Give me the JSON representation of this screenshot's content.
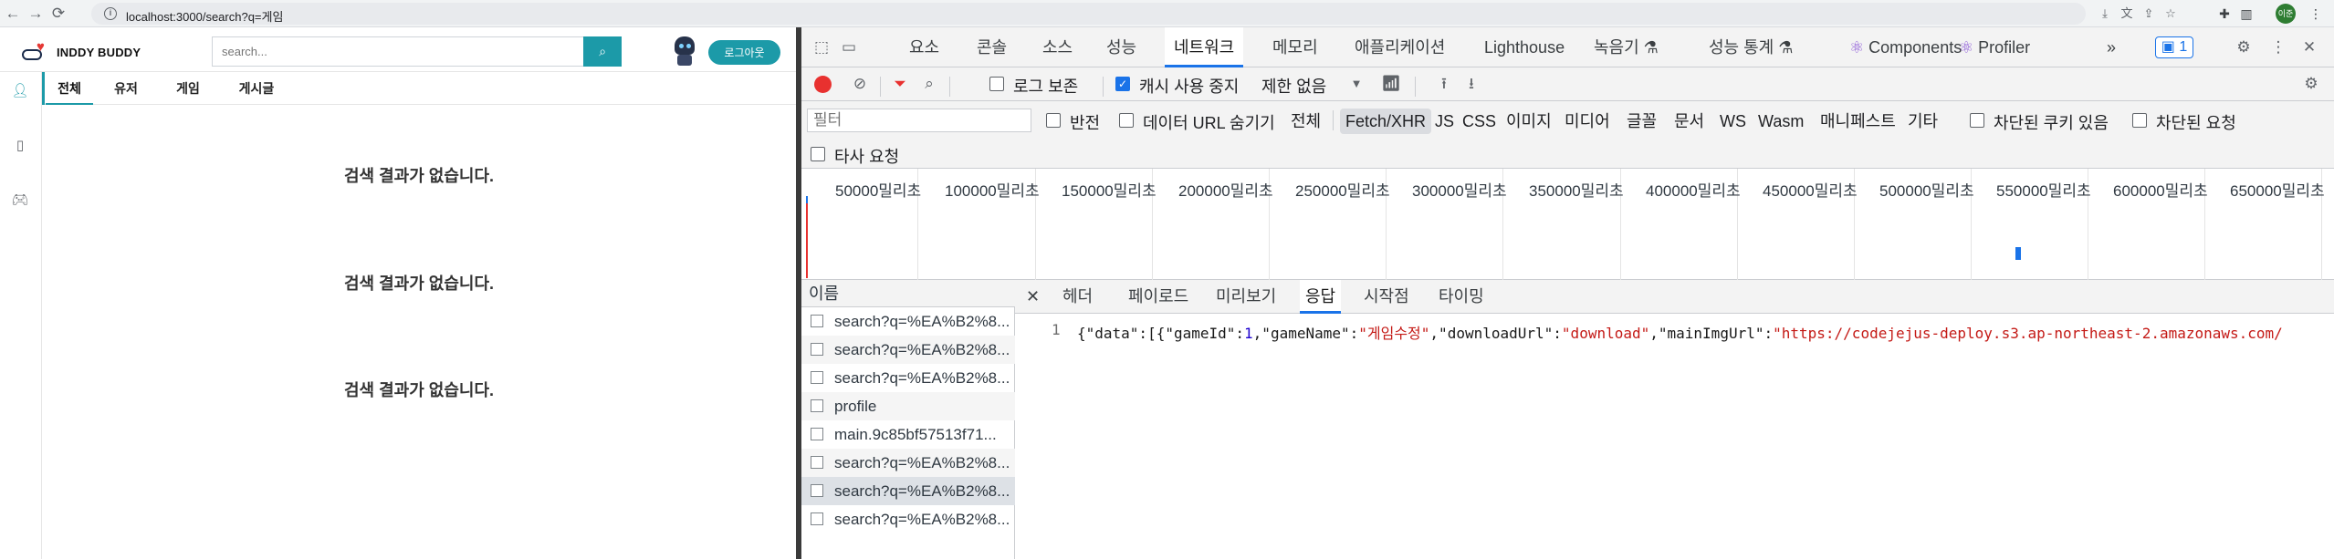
{
  "browser": {
    "url": "localhost:3000/search?q=게임",
    "profile_initials": "이준"
  },
  "site": {
    "brand": "INDDY BUDDY",
    "search_placeholder": "search...",
    "login_label": "로그아웃",
    "tabs": [
      "전체",
      "유저",
      "게임",
      "게시글"
    ],
    "empty_message": "검색 결과가 없습니다."
  },
  "devtools": {
    "tabs": [
      "요소",
      "콘솔",
      "소스",
      "성능",
      "네트워크",
      "메모리",
      "애플리케이션",
      "Lighthouse",
      "녹음기 ⚗",
      "성능 통계 ⚗",
      "Components",
      "Profiler"
    ],
    "selected_tab": "네트워크",
    "issues_count": "1",
    "toolbar": {
      "preserve_log": "로그 보존",
      "disable_cache": "캐시 사용 중지",
      "throttling": "제한 없음"
    },
    "filter": {
      "placeholder": "필터",
      "invert": "반전",
      "hide_data_urls": "데이터 URL 숨기기",
      "types": [
        "전체",
        "Fetch/XHR",
        "JS",
        "CSS",
        "이미지",
        "미디어",
        "글꼴",
        "문서",
        "WS",
        "Wasm",
        "매니페스트",
        "기타"
      ],
      "selected_type": "Fetch/XHR",
      "blocked_cookies": "차단된 쿠키 있음",
      "blocked_requests": "차단된 요청",
      "third_party": "타사 요청"
    },
    "timeline_labels": [
      "50000밀리초",
      "100000밀리초",
      "150000밀리초",
      "200000밀리초",
      "250000밀리초",
      "300000밀리초",
      "350000밀리초",
      "400000밀리초",
      "450000밀리초",
      "500000밀리초",
      "550000밀리초",
      "600000밀리초",
      "650000밀리초"
    ],
    "name_header": "이름",
    "requests": [
      "search?q=%EA%B2%8...",
      "search?q=%EA%B2%8...",
      "search?q=%EA%B2%8...",
      "profile",
      "main.9c85bf57513f71...",
      "search?q=%EA%B2%8...",
      "search?q=%EA%B2%8...",
      "search?q=%EA%B2%8..."
    ],
    "detail_tabs": [
      "헤더",
      "페이로드",
      "미리보기",
      "응답",
      "시작점",
      "타이밍"
    ],
    "selected_detail_tab": "응답",
    "response": {
      "line_number": "1",
      "p1": "{\"data\":[{\"gameId\":",
      "gameId": "1",
      "p2": ",\"gameName\":",
      "gameName": "\"게임수정\"",
      "p3": ",\"downloadUrl\":",
      "downloadUrl": "\"download\"",
      "p4": ",\"mainImgUrl\":",
      "mainImgUrl": "\"https://codejejus-deploy.s3.ap-northeast-2.amazonaws.com/"
    }
  }
}
